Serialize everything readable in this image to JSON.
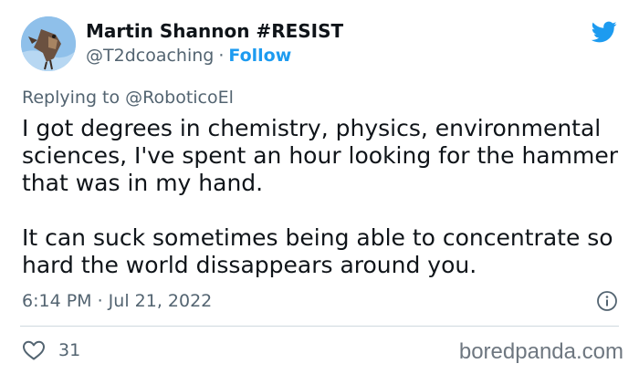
{
  "tweet": {
    "author_name": "Martin Shannon #RESIST",
    "handle": "@T2dcoaching",
    "separator": "·",
    "follow_label": "Follow",
    "replying_prefix": "Replying to",
    "replying_to": "@RoboticoEl",
    "paragraphs": [
      "I got degrees in chemistry, physics, environmental sciences, I've spent an hour looking for the hammer that was in my hand.",
      "It can suck sometimes being able to concentrate so hard the world dissappears around you."
    ],
    "timestamp": "6:14 PM · Jul 21, 2022",
    "like_count": "31"
  },
  "icons": {
    "platform": "twitter-bird-icon",
    "info": "info-icon",
    "like": "heart-icon"
  },
  "colors": {
    "accent": "#1d9bf0",
    "text": "#0f1419",
    "secondary": "#536471"
  },
  "watermark": "boredpanda.com"
}
